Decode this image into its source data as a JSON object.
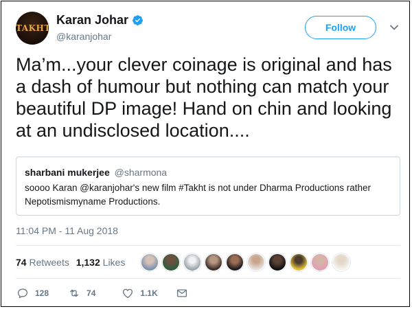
{
  "author": {
    "avatar_text": "TAKHT",
    "display_name": "Karan Johar",
    "handle": "@karanjohar"
  },
  "follow_label": "Follow",
  "tweet_text": "Ma’m...your clever coinage is original and has a dash of humour but nothing can match your beautiful DP image! Hand on chin and looking at an undisclosed location....",
  "quote": {
    "name": "sharbani mukerjee",
    "handle": "@sharmona",
    "text": "soooo Karan @karanjohar's new film #Takht is not under Dharma Productions rather Nepotismismyname Productions."
  },
  "timestamp": "11:04 PM - 11 Aug 2018",
  "stats": {
    "retweets_count": "74",
    "retweets_label": "Retweets",
    "likes_count": "1,132",
    "likes_label": "Likes"
  },
  "actions": {
    "reply_count": "128",
    "retweet_count": "74",
    "like_count": "1.1K"
  },
  "colors": {
    "accent": "#1da1f2",
    "text": "#14171a",
    "muted": "#657786",
    "border": "#ccd6dd"
  },
  "icons": [
    "verified-badge-icon",
    "chevron-down-icon",
    "reply-icon",
    "retweet-icon",
    "heart-icon",
    "envelope-icon"
  ]
}
